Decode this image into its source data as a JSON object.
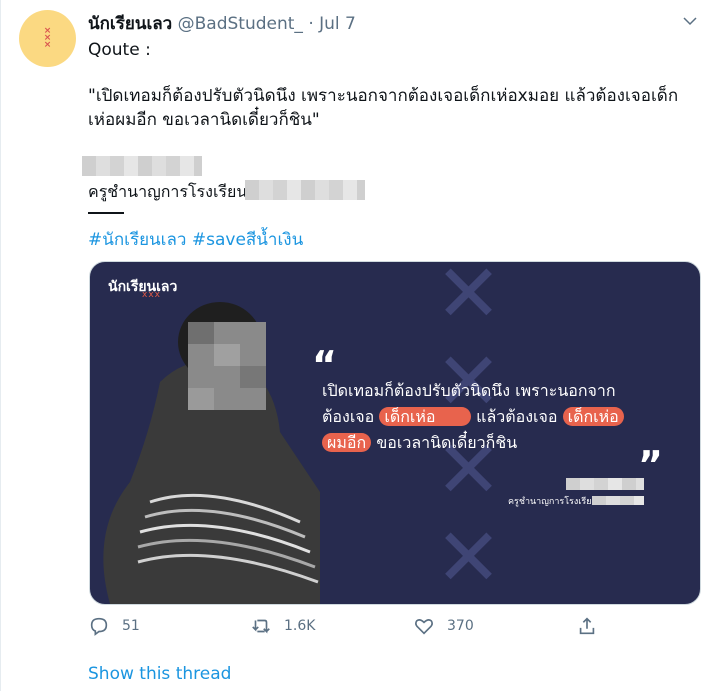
{
  "author": {
    "name": "นักเรียนเลว",
    "handle": "@BadStudent_",
    "separator": "·",
    "date": "Jul 7"
  },
  "tweet": {
    "line1": "Qoute :",
    "quote": "\"เปิดเทอมก็ต้องปรับตัวนิดนึง เพราะนอกจากต้องเจอเด็กเห่อxมอย แล้วต้องเจอเด็กเห่อผมอีก ขอเวลานิดเดี๋ยวก็ชิน\"",
    "teacher_label": "ครูชำนาญการโรงเรียน",
    "hashtags": [
      "#นักเรียนเลว",
      "#saveสีน้ำเงิน"
    ]
  },
  "card": {
    "brand": "นักเรียนเลว",
    "brand_mark": "xxx",
    "quote_open": "“",
    "quote_close": "”",
    "q_line1": "เปิดเทอมก็ต้องปรับตัวนิดนึง เพราะนอกจาก",
    "q_line2a": "ต้องเจอ",
    "q_hl1": "เด็กเห่อ",
    "q_line2b": "แล้วต้องเจอ",
    "q_hl2": "เด็กเห่อ",
    "q_hl3": "ผมอีก",
    "q_line3": "ขอเวลานิดเดี๋ยวก็ชิน",
    "teacher_small": "ครูชำนาญการโรงเรียน",
    "bg_color": "#272b4f",
    "accent_color": "#e8634d"
  },
  "actions": {
    "reply_count": "51",
    "retweet_count": "1.6K",
    "like_count": "370"
  },
  "show_thread": "Show this thread",
  "colors": {
    "link": "#1b95e0",
    "muted": "#5b7083"
  }
}
